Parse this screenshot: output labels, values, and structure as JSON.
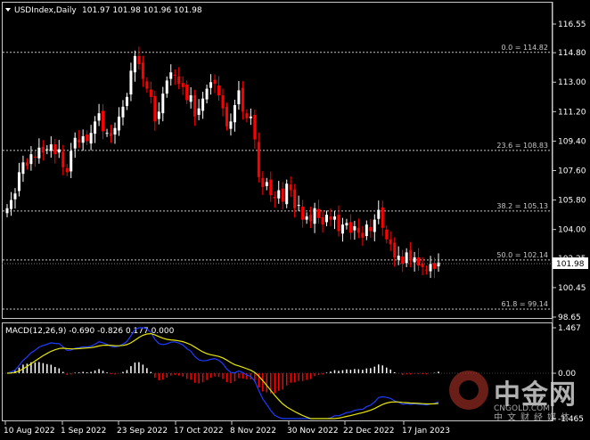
{
  "header": {
    "symbol_label": "USDIndex,Daily",
    "ohlc": "101.97 101.98 101.96 101.98"
  },
  "price_axis": {
    "ticks": [
      "116.55",
      "114.80",
      "113.00",
      "111.20",
      "109.40",
      "107.60",
      "105.80",
      "104.00",
      "102.25",
      "100.45",
      "98.65"
    ],
    "current_price": "101.98"
  },
  "fibonacci": [
    {
      "label": "0.0 = 114.82",
      "price": 114.82
    },
    {
      "label": "23.6 = 108.83",
      "price": 108.83
    },
    {
      "label": "38.2 = 105.13",
      "price": 105.13
    },
    {
      "label": "50.0 = 102.14",
      "price": 102.14
    },
    {
      "label": "61.8 = 99.14",
      "price": 99.14
    }
  ],
  "macd": {
    "label": "MACD(12,26,9) -0.690 -0.826 0.177 0.000",
    "ticks": [
      "1.467",
      "0.00",
      "-1.465"
    ]
  },
  "time_axis": [
    "10 Aug 2022",
    "1 Sep 2022",
    "23 Sep 2022",
    "17 Oct 2022",
    "8 Nov 2022",
    "30 Nov 2022",
    "22 Dec 2022",
    "17 Jan 2023"
  ],
  "watermark": {
    "title": "中金网",
    "site": "CNGOLD.COM",
    "tagline": "中文财经媒体"
  },
  "colors": {
    "bull": "#ffffff",
    "bear": "#ff0000",
    "macd_main": "#1e3cff",
    "macd_signal": "#e6e600",
    "grid": "#c8c8c8"
  },
  "chart_data": {
    "type": "candlestick",
    "close_series": [
      105.3,
      105.8,
      106.2,
      107.5,
      108.1,
      107.9,
      108.6,
      108.4,
      109.0,
      108.7,
      108.9,
      109.2,
      108.6,
      108.9,
      107.8,
      107.5,
      108.8,
      109.6,
      109.3,
      109.7,
      109.4,
      109.9,
      110.6,
      111.1,
      110.0,
      109.9,
      109.7,
      110.2,
      110.9,
      111.5,
      112.1,
      113.7,
      114.6,
      114.1,
      113.2,
      112.6,
      112.1,
      110.6,
      111.2,
      112.3,
      113.1,
      113.6,
      113.4,
      112.9,
      112.7,
      111.9,
      112.2,
      110.9,
      111.4,
      112.0,
      112.6,
      113.0,
      112.9,
      112.2,
      111.4,
      110.3,
      110.6,
      111.6,
      112.5,
      111.2,
      110.8,
      110.9,
      109.5,
      107.2,
      106.6,
      106.9,
      106.1,
      105.9,
      106.4,
      105.7,
      106.8,
      106.4,
      105.3,
      105.5,
      104.6,
      104.8,
      104.5,
      105.3,
      104.7,
      104.3,
      104.9,
      104.6,
      104.8,
      103.9,
      104.3,
      104.4,
      103.8,
      104.2,
      103.8,
      103.5,
      104.3,
      103.9,
      104.6,
      105.2,
      104.1,
      103.4,
      103.1,
      102.3,
      102.4,
      101.9,
      102.6,
      102.1,
      102.3,
      101.8,
      101.7,
      101.5,
      101.9,
      101.6,
      101.98
    ],
    "macd_ticks": [
      1.467,
      0.0,
      -1.465
    ],
    "price_ylim": [
      98.65,
      116.55
    ]
  }
}
